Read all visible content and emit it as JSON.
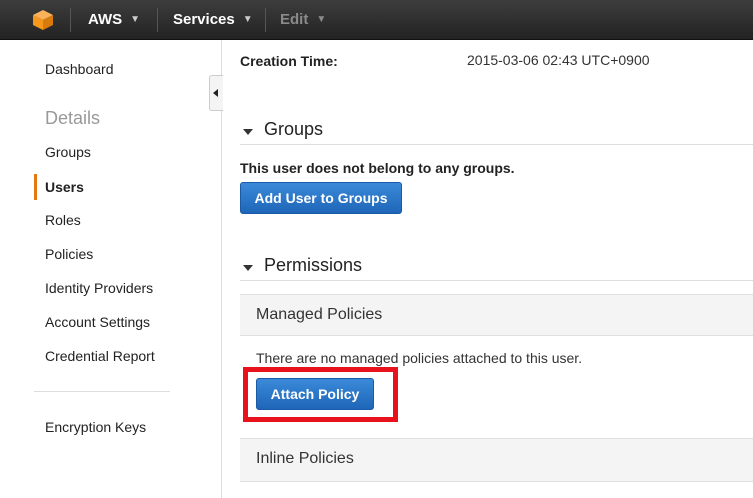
{
  "topbar": {
    "brand": "AWS",
    "services": "Services",
    "edit": "Edit",
    "logo_color": "#f7981d"
  },
  "sidebar": {
    "dashboard": "Dashboard",
    "details_heading": "Details",
    "items": [
      "Groups",
      "Users",
      "Roles",
      "Policies",
      "Identity Providers",
      "Account Settings",
      "Credential Report"
    ],
    "active_item": "Users",
    "encryption": "Encryption Keys"
  },
  "main": {
    "creation_label": "Creation Time:",
    "creation_value": "2015-03-06 02:43 UTC+0900",
    "groups": {
      "title": "Groups",
      "message": "This user does not belong to any groups.",
      "button": "Add User to Groups"
    },
    "permissions": {
      "title": "Permissions",
      "managed_title": "Managed Policies",
      "managed_message": "There are no managed policies attached to this user.",
      "attach_button": "Attach Policy",
      "inline_title": "Inline Policies"
    }
  },
  "colors": {
    "accent": "#e47911",
    "button_blue": "#2a78cc",
    "highlight": "#e8121c"
  }
}
